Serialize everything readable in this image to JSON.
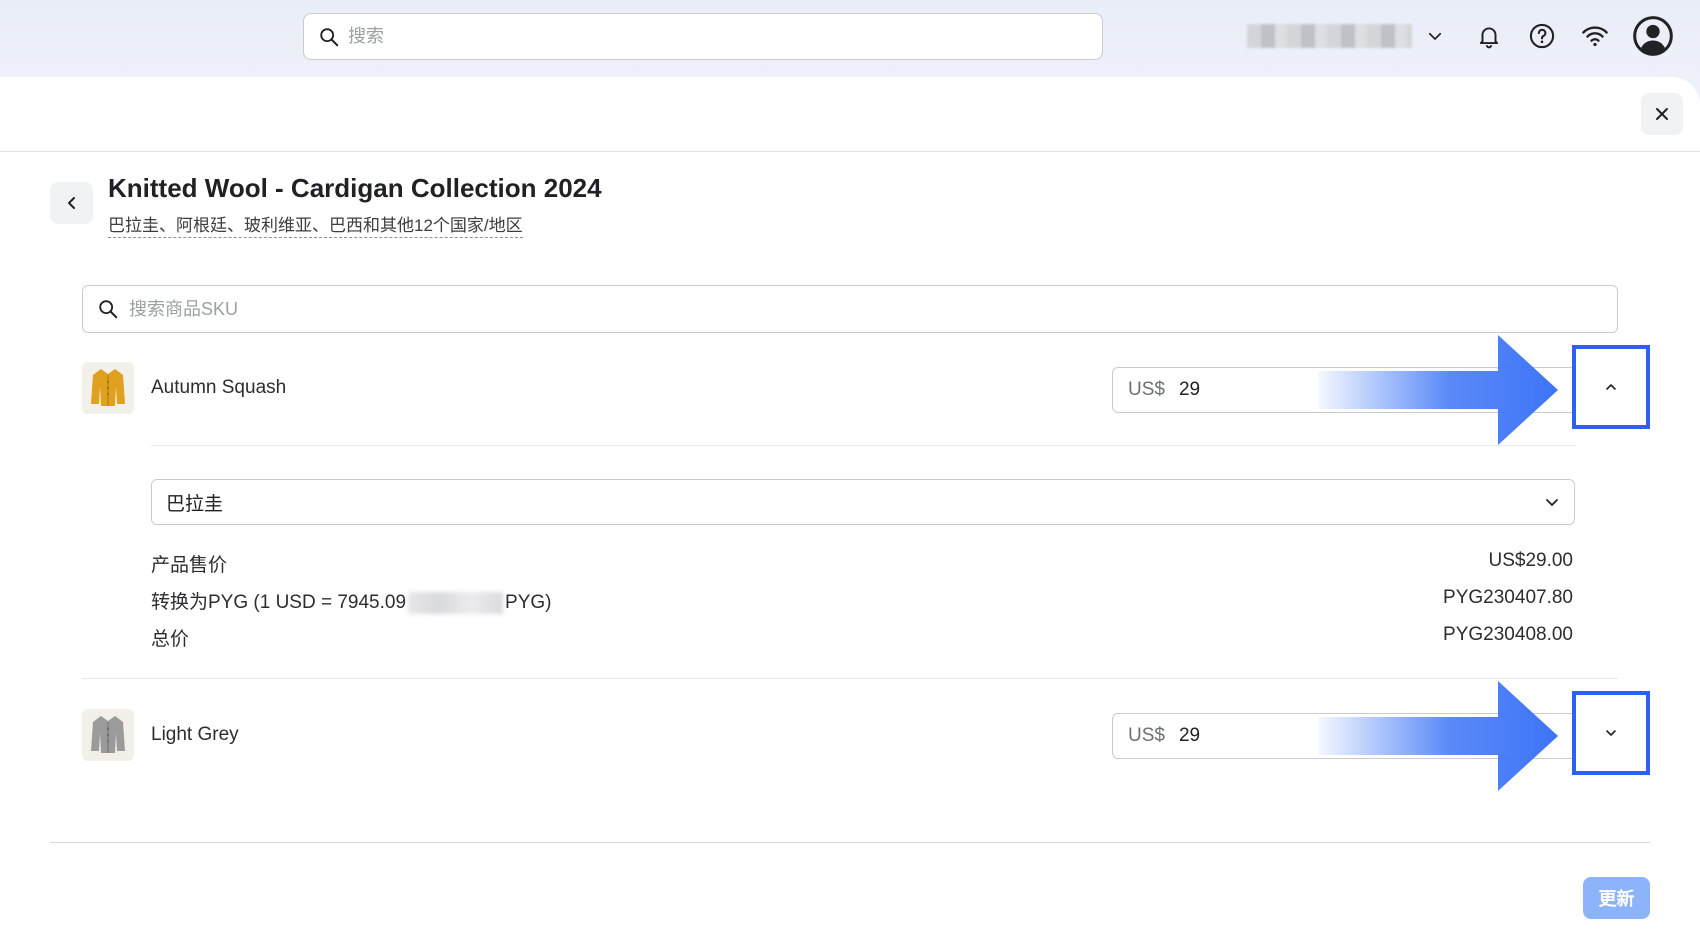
{
  "topbar": {
    "search_placeholder": "搜索"
  },
  "panel": {
    "title": "Knitted Wool - Cardigan Collection 2024",
    "subtitle": "巴拉圭、阿根廷、玻利维亚、巴西和其他12个国家/地区",
    "sku_search_placeholder": "搜索商品SKU"
  },
  "products": [
    {
      "name": "Autumn Squash",
      "currency_prefix": "US$",
      "price": "29",
      "expanded": true,
      "thumb_color": "#e0a020"
    },
    {
      "name": "Light Grey",
      "currency_prefix": "US$",
      "price": "29",
      "expanded": false,
      "thumb_color": "#9b9b9b"
    }
  ],
  "details": {
    "country": "巴拉圭",
    "sale_price_label": "产品售价",
    "sale_price_value": "US$29.00",
    "conversion_label_prefix": "转换为PYG (1 USD = 7945.09",
    "conversion_label_suffix": "PYG)",
    "conversion_value": "PYG230407.80",
    "total_label": "总价",
    "total_value": "PYG230408.00"
  },
  "footer": {
    "update_label": "更新"
  },
  "colors": {
    "highlight": "#2f5ff5",
    "arrow": "#3d74f7",
    "update_button": "#8db4fb"
  }
}
